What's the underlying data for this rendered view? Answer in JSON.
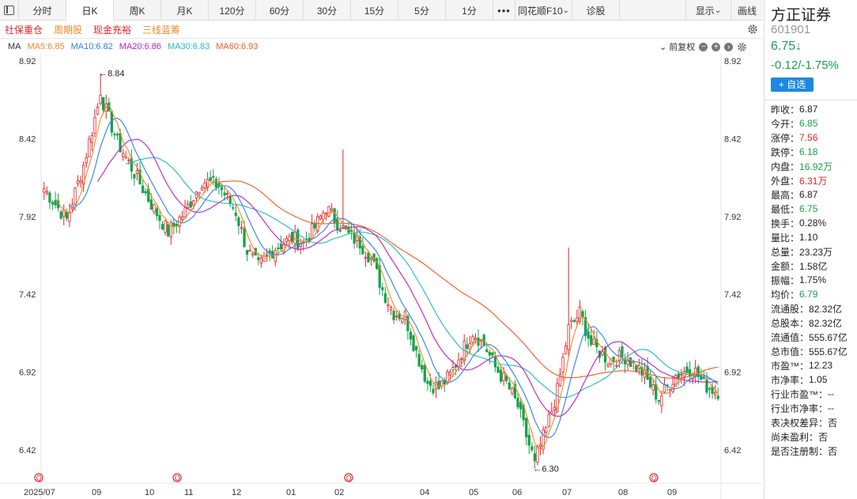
{
  "tabs": [
    "分时",
    "日K",
    "周K",
    "月K",
    "120分",
    "60分",
    "30分",
    "15分",
    "5分",
    "1分",
    "•••",
    "同花顺F10",
    "诊股"
  ],
  "right_tabs": {
    "display": "显示",
    "draw": "画线"
  },
  "tags": [
    "社保重仓",
    "周期股",
    "现金充裕",
    "三线蓝筹"
  ],
  "ma_legend": {
    "label": "MA",
    "ma5": "MA5:6.85",
    "ma10": "MA10:6.82",
    "ma20": "MA20:6.86",
    "ma30": "MA30:6.83",
    "ma60": "MA60:6.93"
  },
  "fuquan": "前复权",
  "colors": {
    "up": "#e0262b",
    "down": "#16a34a",
    "ma5": "#f08a24",
    "ma10": "#2f80ed",
    "ma20": "#c21dc2",
    "ma30": "#20b8c8",
    "ma60": "#f05a1e"
  },
  "stock": {
    "name": "方正证券",
    "code": "601901",
    "price": "6.75↓",
    "change": "-0.12/-1.75%",
    "add": "+ 自选"
  },
  "stats": [
    {
      "label": "昨收：",
      "value": "6.87",
      "color": ""
    },
    {
      "label": "今开：",
      "value": "6.85",
      "color": "g"
    },
    {
      "label": "涨停：",
      "value": "7.56",
      "color": "r"
    },
    {
      "label": "跌停：",
      "value": "6.18",
      "color": "g"
    },
    {
      "label": "内盘：",
      "value": "16.92万",
      "color": "g"
    },
    {
      "label": "外盘：",
      "value": "6.31万",
      "color": "r"
    },
    {
      "label": "最高：",
      "value": "6.87",
      "color": ""
    },
    {
      "label": "最低：",
      "value": "6.75",
      "color": "g"
    },
    {
      "label": "换手：",
      "value": "0.28%",
      "color": ""
    },
    {
      "label": "量比：",
      "value": "1.10",
      "color": ""
    },
    {
      "label": "总量：",
      "value": "23.23万",
      "color": ""
    },
    {
      "label": "金额：",
      "value": "1.58亿",
      "color": ""
    },
    {
      "label": "振幅：",
      "value": "1.75%",
      "color": ""
    },
    {
      "label": "均价：",
      "value": "6.79",
      "color": "g"
    },
    {
      "label": "流通股：",
      "value": "82.32亿",
      "color": ""
    },
    {
      "label": "总股本：",
      "value": "82.32亿",
      "color": ""
    },
    {
      "label": "流通值：",
      "value": "555.67亿",
      "color": ""
    },
    {
      "label": "总市值：",
      "value": "555.67亿",
      "color": ""
    },
    {
      "label": "市盈™：",
      "value": "12.23",
      "color": ""
    },
    {
      "label": "市净率：",
      "value": "1.05",
      "color": ""
    },
    {
      "label": "行业市盈™：",
      "value": "--",
      "color": ""
    },
    {
      "label": "行业市净率：",
      "value": "--",
      "color": ""
    },
    {
      "label": "表决权差异：",
      "value": "否",
      "color": ""
    },
    {
      "label": "尚未盈利：",
      "value": "否",
      "color": ""
    },
    {
      "label": "是否注册制：",
      "value": "否",
      "color": ""
    }
  ],
  "chart_data": {
    "type": "candlestick",
    "ylim": [
      6.3,
      8.92
    ],
    "y_ticks": [
      "8.92",
      "8.42",
      "7.92",
      "7.42",
      "6.92",
      "6.42"
    ],
    "x_labels": [
      "2025/07",
      "09",
      "10",
      "11",
      "12",
      "01",
      "02",
      "04",
      "05",
      "06",
      "07",
      "08",
      "09"
    ],
    "annotations": [
      {
        "text": "←8.84",
        "value": 8.84
      },
      {
        "text": "←6.30",
        "value": 6.3
      }
    ],
    "event_markers": 4,
    "anchors": [
      [
        0,
        8.1
      ],
      [
        8,
        7.9
      ],
      [
        14,
        8.25
      ],
      [
        20,
        8.7
      ],
      [
        26,
        8.4
      ],
      [
        32,
        8.2
      ],
      [
        38,
        8.0
      ],
      [
        44,
        7.82
      ],
      [
        50,
        7.95
      ],
      [
        56,
        8.15
      ],
      [
        62,
        8.12
      ],
      [
        68,
        7.95
      ],
      [
        72,
        7.7
      ],
      [
        76,
        7.6
      ],
      [
        82,
        7.72
      ],
      [
        88,
        7.78
      ],
      [
        92,
        7.75
      ],
      [
        96,
        7.85
      ],
      [
        100,
        7.98
      ],
      [
        104,
        7.88
      ],
      [
        108,
        7.8
      ],
      [
        112,
        7.75
      ],
      [
        116,
        7.65
      ],
      [
        120,
        7.45
      ],
      [
        124,
        7.3
      ],
      [
        128,
        7.28
      ],
      [
        132,
        7.05
      ],
      [
        136,
        6.85
      ],
      [
        140,
        6.82
      ],
      [
        144,
        6.9
      ],
      [
        148,
        7.05
      ],
      [
        152,
        7.18
      ],
      [
        156,
        7.1
      ],
      [
        160,
        6.95
      ],
      [
        164,
        6.85
      ],
      [
        168,
        6.7
      ],
      [
        172,
        6.45
      ],
      [
        174,
        6.35
      ],
      [
        178,
        6.55
      ],
      [
        182,
        6.8
      ],
      [
        186,
        7.2
      ],
      [
        190,
        7.3
      ],
      [
        194,
        7.1
      ],
      [
        200,
        7.0
      ],
      [
        206,
        7.02
      ],
      [
        212,
        6.92
      ],
      [
        218,
        6.75
      ],
      [
        224,
        6.9
      ],
      [
        230,
        6.95
      ],
      [
        234,
        6.84
      ],
      [
        238,
        6.8
      ]
    ],
    "ma5_last": 6.85,
    "ma10_last": 6.82,
    "ma20_last": 6.86,
    "ma30_last": 6.83,
    "ma60_last": 6.93
  }
}
